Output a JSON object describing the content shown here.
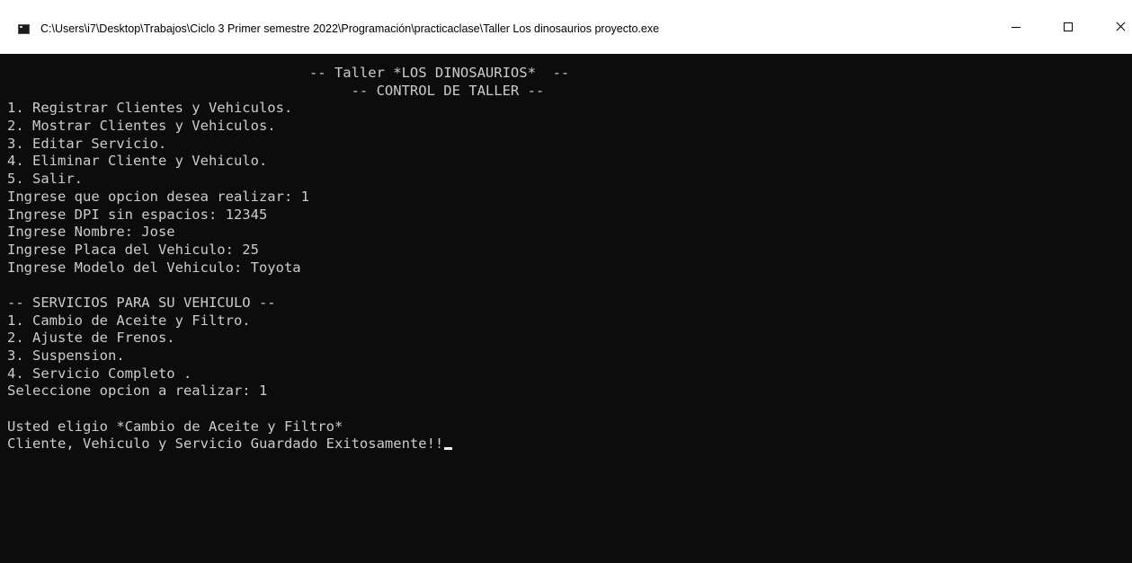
{
  "window": {
    "title": "C:\\Users\\i7\\Desktop\\Trabajos\\Ciclo 3 Primer semestre 2022\\Programación\\practicaclase\\Taller Los dinosaurios proyecto.exe",
    "icon": "console-app-icon",
    "controls": {
      "minimize_icon": "minimize-icon",
      "maximize_icon": "maximize-icon",
      "close_icon": "close-icon"
    }
  },
  "console": {
    "header_title": "                                    -- Taller *LOS DINOSAURIOS*  --",
    "header_subtitle": "                                         -- CONTROL DE TALLER --",
    "menu_items": [
      "1. Registrar Clientes y Vehiculos.",
      "2. Mostrar Clientes y Vehiculos.",
      "3. Editar Servicio.",
      "4. Eliminar Cliente y Vehiculo.",
      "5. Salir."
    ],
    "prompts": [
      "Ingrese que opcion desea realizar: 1",
      "Ingrese DPI sin espacios: 12345",
      "Ingrese Nombre: Jose",
      "Ingrese Placa del Vehiculo: 25",
      "Ingrese Modelo del Vehiculo: Toyota"
    ],
    "services_header": "-- SERVICIOS PARA SU VEHICULO --",
    "service_items": [
      "1. Cambio de Aceite y Filtro.",
      "2. Ajuste de Frenos.",
      "3. Suspension.",
      "4. Servicio Completo ."
    ],
    "service_prompt": "Seleccione opcion a realizar: 1",
    "result_choice": "Usted eligio *Cambio de Aceite y Filtro*",
    "result_saved": "Cliente, Vehiculo y Servicio Guardado Exitosamente!!"
  },
  "colors": {
    "console_background": "#0c0c0c",
    "console_text": "#cccccc",
    "titlebar_background": "#ffffff"
  }
}
